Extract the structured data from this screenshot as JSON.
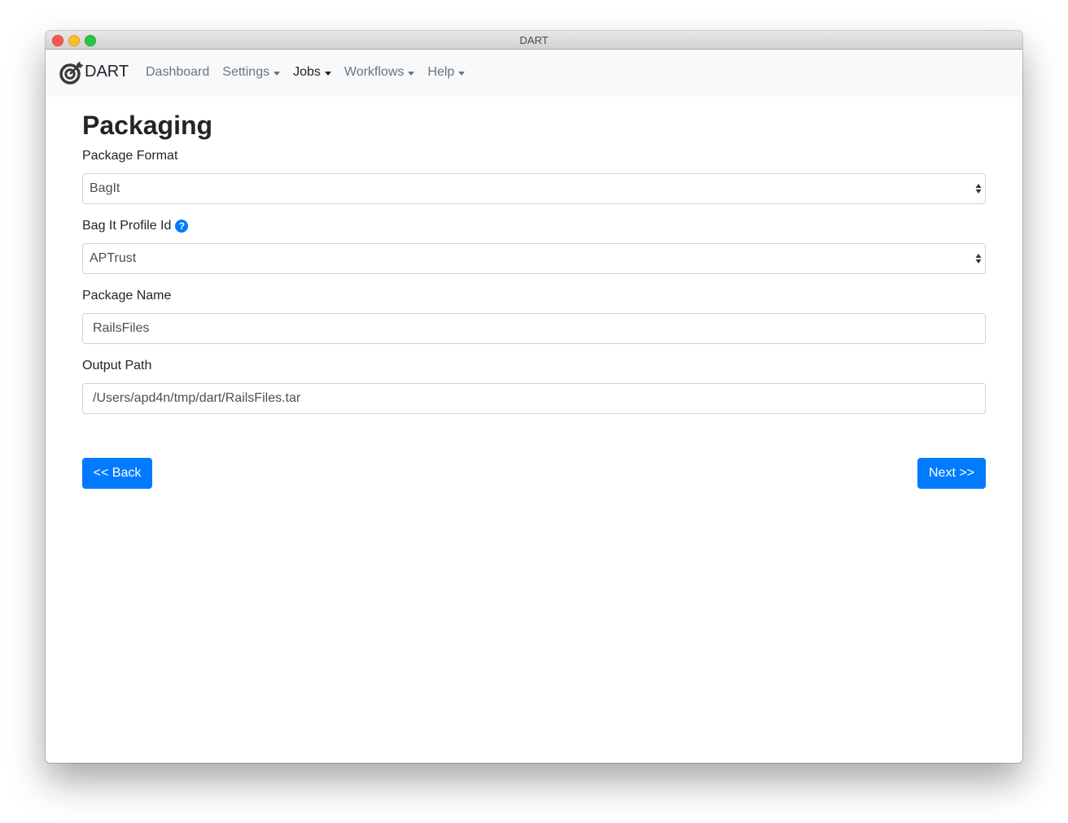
{
  "window": {
    "title": "DART"
  },
  "navbar": {
    "brand": "DART",
    "items": [
      {
        "label": "Dashboard",
        "dropdown": false,
        "active": false
      },
      {
        "label": "Settings",
        "dropdown": true,
        "active": false
      },
      {
        "label": "Jobs",
        "dropdown": true,
        "active": true
      },
      {
        "label": "Workflows",
        "dropdown": true,
        "active": false
      },
      {
        "label": "Help",
        "dropdown": true,
        "active": false
      }
    ]
  },
  "page": {
    "title": "Packaging",
    "fields": {
      "package_format": {
        "label": "Package Format",
        "value": "BagIt"
      },
      "bagit_profile": {
        "label": "Bag It Profile Id",
        "value": "APTrust",
        "help_icon": "question-circle-icon"
      },
      "package_name": {
        "label": "Package Name",
        "value": "RailsFiles"
      },
      "output_path": {
        "label": "Output Path",
        "value": "/Users/apd4n/tmp/dart/RailsFiles.tar"
      }
    },
    "buttons": {
      "back": "<< Back",
      "next": "Next >>"
    }
  },
  "colors": {
    "primary": "#007bff",
    "navbar_bg": "#f8f9fa",
    "text": "#212529",
    "muted": "#6c757d"
  }
}
